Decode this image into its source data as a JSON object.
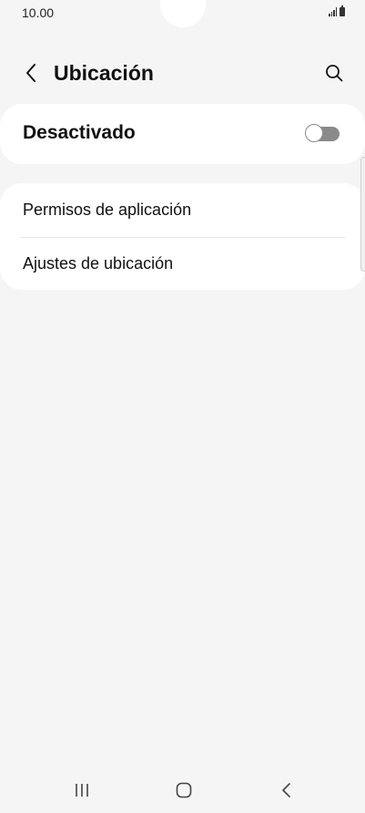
{
  "status_bar": {
    "time": "10.00",
    "icons": [
      "signal-icon",
      "battery-icon"
    ]
  },
  "app_bar": {
    "title": "Ubicación",
    "back_icon": "chevron-left-icon",
    "search_icon": "search-icon"
  },
  "master_switch": {
    "label": "Desactivado",
    "state": "off"
  },
  "settings_list": {
    "items": [
      {
        "label": "Permisos de aplicación"
      },
      {
        "label": "Ajustes de ubicación"
      }
    ]
  },
  "navigation_bar": {
    "buttons": [
      "recent-apps-icon",
      "home-icon",
      "back-icon"
    ]
  },
  "colors": {
    "background": "#f5f5f5",
    "card": "#ffffff",
    "toggle_off": "#8a8a8a"
  }
}
